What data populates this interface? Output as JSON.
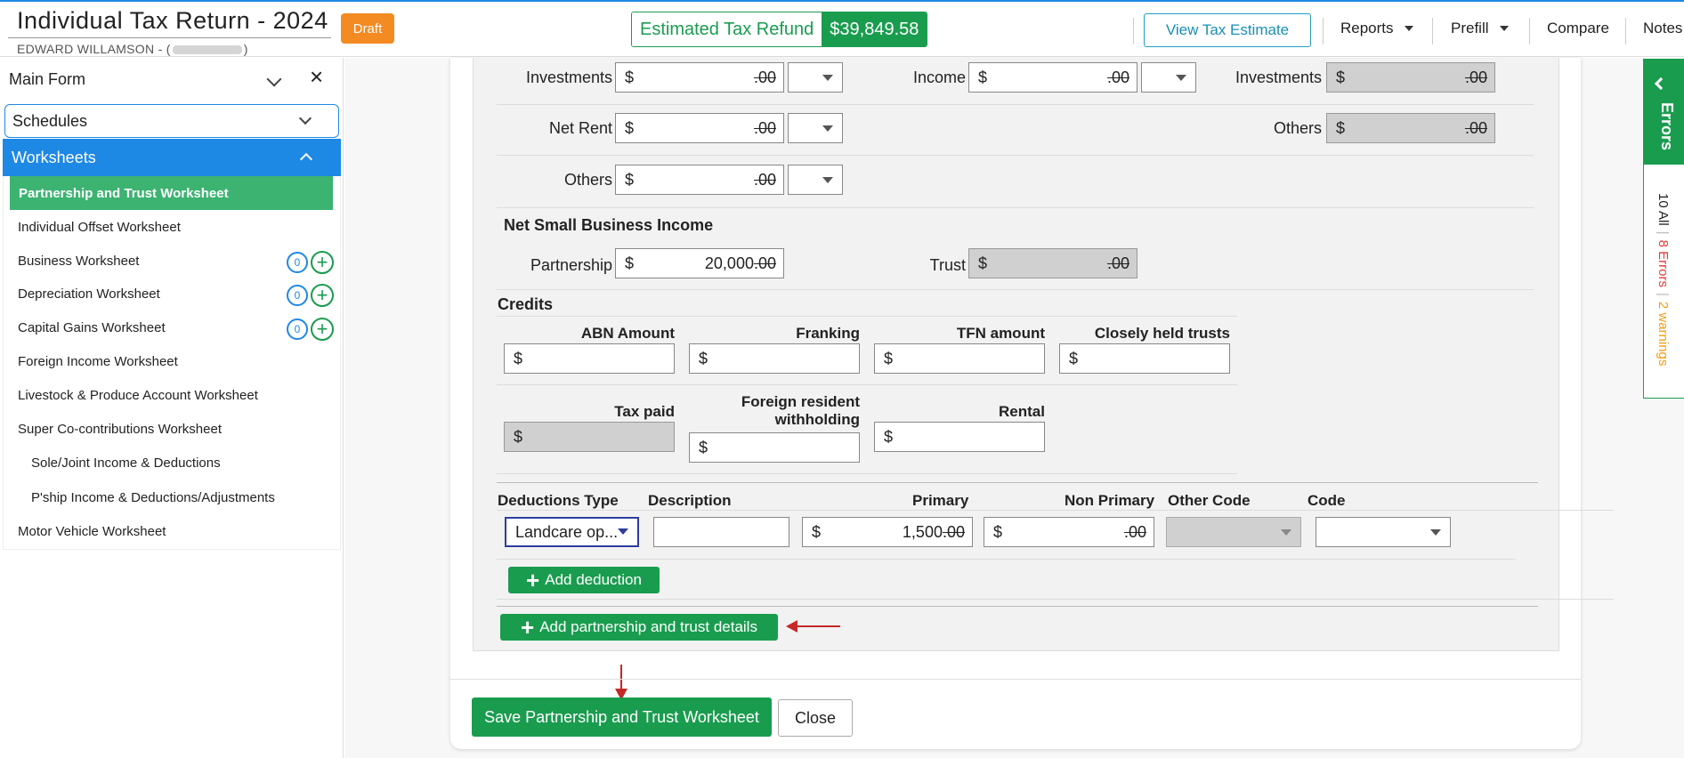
{
  "header": {
    "title": "Individual Tax Return - 2024",
    "client_prefix": "EDWARD WILLAMSON - (",
    "client_suffix": ")",
    "status_badge": "Draft",
    "refund_label": "Estimated Tax Refund",
    "refund_amount": "$39,849.58",
    "view_estimate": "View Tax Estimate",
    "nav": {
      "reports": "Reports",
      "prefill": "Prefill",
      "compare": "Compare",
      "notes": "Notes"
    }
  },
  "sidebar": {
    "main_form": "Main Form",
    "schedules": "Schedules",
    "worksheets": "Worksheets",
    "items": [
      {
        "label": "Partnership and Trust Worksheet",
        "active": true
      },
      {
        "label": "Individual Offset Worksheet"
      },
      {
        "label": "Business Worksheet",
        "count": "0"
      },
      {
        "label": "Depreciation Worksheet",
        "count": "0"
      },
      {
        "label": "Capital Gains Worksheet",
        "count": "0"
      },
      {
        "label": "Foreign Income Worksheet"
      },
      {
        "label": "Livestock & Produce Account Worksheet"
      },
      {
        "label": "Super Co-contributions Worksheet"
      },
      {
        "label": "Sole/Joint Income & Deductions"
      },
      {
        "label": "P'ship Income & Deductions/Adjustments"
      },
      {
        "label": "Motor Vehicle Worksheet"
      }
    ]
  },
  "form": {
    "currency": "$",
    "rows": {
      "investments_left": {
        "label": "Investments",
        "whole": "",
        "cents": ".00"
      },
      "income": {
        "label": "Income",
        "whole": "",
        "cents": ".00"
      },
      "investments_right": {
        "label": "Investments",
        "whole": "",
        "cents": ".00"
      },
      "net_rent": {
        "label": "Net Rent",
        "whole": "",
        "cents": ".00"
      },
      "others_right": {
        "label": "Others",
        "whole": "",
        "cents": ".00"
      },
      "others_left": {
        "label": "Others",
        "whole": "",
        "cents": ".00"
      }
    },
    "net_small_business": {
      "title": "Net Small Business Income",
      "partnership_label": "Partnership",
      "partnership_whole": "20,000",
      "partnership_cents": ".00",
      "trust_label": "Trust",
      "trust_whole": "",
      "trust_cents": ".00"
    },
    "credits": {
      "title": "Credits",
      "abn": "ABN Amount",
      "franking": "Franking",
      "tfn": "TFN amount",
      "closely_held": "Closely held trusts",
      "tax_paid": "Tax paid",
      "foreign_line1": "Foreign resident",
      "foreign_line2": "withholding",
      "rental": "Rental"
    },
    "deductions": {
      "headers": {
        "type": "Deductions Type",
        "description": "Description",
        "primary": "Primary",
        "non_primary": "Non Primary",
        "other_code": "Other Code",
        "code": "Code"
      },
      "row": {
        "type": "Landcare op...",
        "primary_whole": "1,500",
        "primary_cents": ".00",
        "non_primary_whole": "",
        "non_primary_cents": ".00"
      },
      "add_label": "Add deduction"
    },
    "add_details_label": "Add partnership and trust details"
  },
  "footer": {
    "save_label": "Save Partnership and Trust Worksheet",
    "close_label": "Close"
  },
  "errors_panel": {
    "title": "Errors",
    "all": "10 All",
    "errors": "8 Errors",
    "warnings": "2 warnings"
  },
  "colors": {
    "accent_blue": "#1e88e5",
    "brand_green": "#1a9c4f",
    "draft_orange": "#f38b22",
    "annotation_red": "#c62828"
  }
}
